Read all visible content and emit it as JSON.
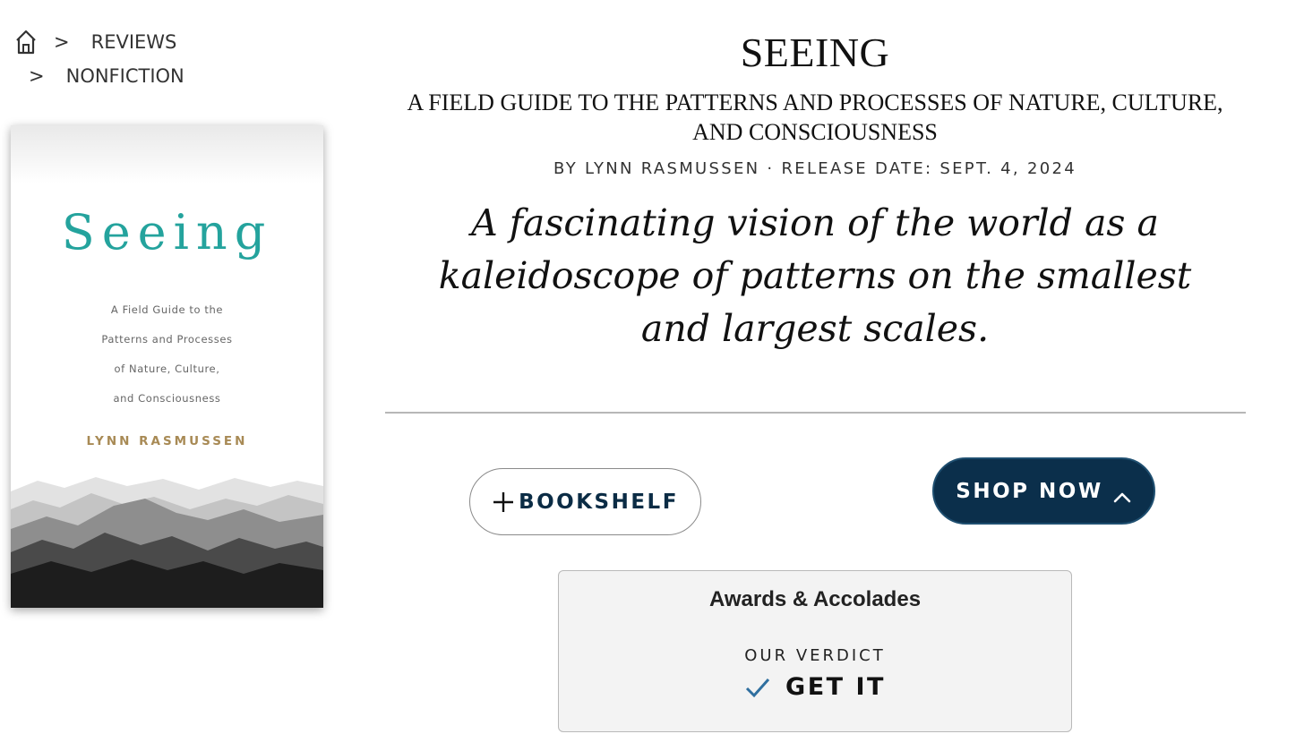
{
  "breadcrumb": {
    "home_icon": "home-icon",
    "separator": ">",
    "items": [
      {
        "label": "REVIEWS"
      },
      {
        "label": "NONFICTION"
      }
    ]
  },
  "cover": {
    "title": "Seeing",
    "subtitle_lines": [
      "A Field Guide to the",
      "Patterns and Processes",
      "of Nature, Culture,",
      "and Consciousness"
    ],
    "author": "LYNN RASMUSSEN",
    "title_color": "#24a39d"
  },
  "book": {
    "title": "SEEING",
    "subtitle": "A FIELD GUIDE TO THE PATTERNS AND PROCESSES OF NATURE, CULTURE, AND CONSCIOUSNESS",
    "byline": "BY LYNN RASMUSSEN · RELEASE DATE: SEPT. 4, 2024",
    "tagline": "A fascinating vision of the world as a kaleidoscope of patterns on the smallest and largest scales."
  },
  "actions": {
    "bookshelf_label": "BOOKSHELF",
    "bookshelf_icon": "plus-icon",
    "shop_label": "SHOP NOW",
    "shop_icon": "chevron-up-icon",
    "shop_color": "#0b2f4b"
  },
  "awards": {
    "title": "Awards & Accolades",
    "verdict_label": "OUR VERDICT",
    "verdict_icon": "check-icon",
    "verdict_value": "GET IT",
    "check_color": "#2f6f9f"
  }
}
